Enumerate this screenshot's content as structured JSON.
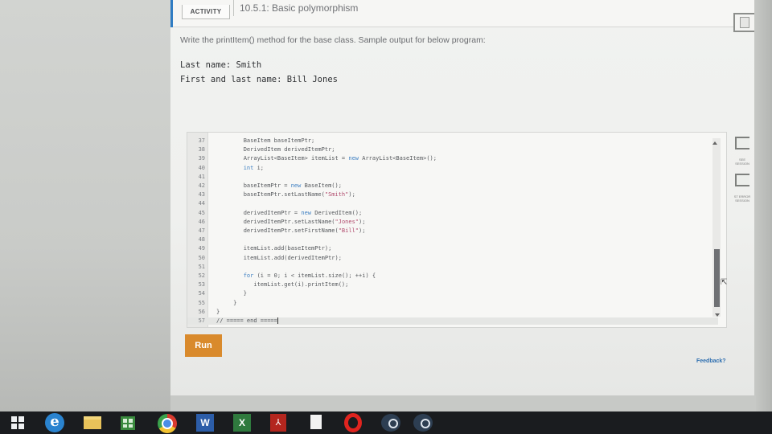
{
  "activity": {
    "tag": "ACTIVITY",
    "title": "10.5.1: Basic polymorphism"
  },
  "instructions": "Write the printItem() method for the base class. Sample output for below program:",
  "sample_output": [
    "Last name: Smith",
    "First and last name: Bill Jones"
  ],
  "code_lines": [
    {
      "num": "37",
      "text": "        BaseItem baseItemPtr;"
    },
    {
      "num": "38",
      "text": "        DerivedItem derivedItemPtr;"
    },
    {
      "num": "39",
      "text": "        ArrayList<BaseItem> itemList = new ArrayList<BaseItem>();"
    },
    {
      "num": "40",
      "text": "        int i;"
    },
    {
      "num": "41",
      "text": ""
    },
    {
      "num": "42",
      "text": "        baseItemPtr = new BaseItem();"
    },
    {
      "num": "43",
      "text": "        baseItemPtr.setLastName(\"Smith\");"
    },
    {
      "num": "44",
      "text": ""
    },
    {
      "num": "45",
      "text": "        derivedItemPtr = new DerivedItem();"
    },
    {
      "num": "46",
      "text": "        derivedItemPtr.setLastName(\"Jones\");"
    },
    {
      "num": "47",
      "text": "        derivedItemPtr.setFirstName(\"Bill\");"
    },
    {
      "num": "48",
      "text": ""
    },
    {
      "num": "49",
      "text": "        itemList.add(baseItemPtr);"
    },
    {
      "num": "50",
      "text": "        itemList.add(derivedItemPtr);"
    },
    {
      "num": "51",
      "text": ""
    },
    {
      "num": "52",
      "text": "        for (i = 0; i < itemList.size(); ++i) {"
    },
    {
      "num": "53",
      "text": "           itemList.get(i).printItem();"
    },
    {
      "num": "54",
      "text": "        }"
    },
    {
      "num": "55",
      "text": "     }"
    },
    {
      "num": "56",
      "text": "}"
    },
    {
      "num": "57",
      "text": "// ===== end ====="
    }
  ],
  "run_label": "Run",
  "feedback_label": "Feedback?",
  "side_labels": {
    "first": "SEE\nSESSION",
    "second": "ST ERROR\nSESSION"
  },
  "taskbar": {
    "word_letter": "W",
    "excel_letter": "X",
    "ie_letter": "e",
    "acrobat_letter": "⅄"
  },
  "colors": {
    "accent": "#2f7cc3",
    "run_button": "#d98a2c",
    "keyword": "#3d7fc2",
    "string": "#b04a6c"
  }
}
